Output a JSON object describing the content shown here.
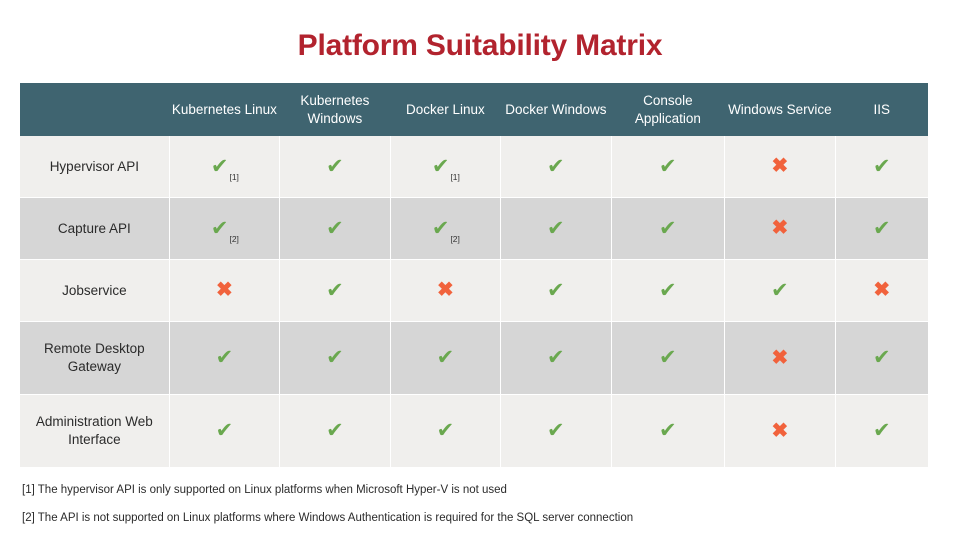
{
  "title": "Platform Suitability Matrix",
  "colors": {
    "title": "#b2232e",
    "header_bg": "#3f6470",
    "row_light": "#f0efed",
    "row_dark": "#d6d6d6",
    "check": "#6aa84f",
    "cross": "#f1623c"
  },
  "table": {
    "corner_header": "",
    "columns": [
      "Kubernetes Linux",
      "Kubernetes Windows",
      "Docker Linux",
      "Docker Windows",
      "Console Application",
      "Windows Service",
      "IIS"
    ],
    "rows": [
      {
        "label": "Hypervisor API",
        "cells": [
          {
            "mark": "check",
            "note": "[1]"
          },
          {
            "mark": "check",
            "note": ""
          },
          {
            "mark": "check",
            "note": "[1]"
          },
          {
            "mark": "check",
            "note": ""
          },
          {
            "mark": "check",
            "note": ""
          },
          {
            "mark": "cross",
            "note": ""
          },
          {
            "mark": "check",
            "note": ""
          }
        ]
      },
      {
        "label": "Capture API",
        "cells": [
          {
            "mark": "check",
            "note": "[2]"
          },
          {
            "mark": "check",
            "note": ""
          },
          {
            "mark": "check",
            "note": "[2]"
          },
          {
            "mark": "check",
            "note": ""
          },
          {
            "mark": "check",
            "note": ""
          },
          {
            "mark": "cross",
            "note": ""
          },
          {
            "mark": "check",
            "note": ""
          }
        ]
      },
      {
        "label": "Jobservice",
        "cells": [
          {
            "mark": "cross",
            "note": ""
          },
          {
            "mark": "check",
            "note": ""
          },
          {
            "mark": "cross",
            "note": ""
          },
          {
            "mark": "check",
            "note": ""
          },
          {
            "mark": "check",
            "note": ""
          },
          {
            "mark": "check",
            "note": ""
          },
          {
            "mark": "cross",
            "note": ""
          }
        ]
      },
      {
        "label": "Remote Desktop Gateway",
        "cells": [
          {
            "mark": "check",
            "note": ""
          },
          {
            "mark": "check",
            "note": ""
          },
          {
            "mark": "check",
            "note": ""
          },
          {
            "mark": "check",
            "note": ""
          },
          {
            "mark": "check",
            "note": ""
          },
          {
            "mark": "cross",
            "note": ""
          },
          {
            "mark": "check",
            "note": ""
          }
        ]
      },
      {
        "label": "Administration Web Interface",
        "cells": [
          {
            "mark": "check",
            "note": ""
          },
          {
            "mark": "check",
            "note": ""
          },
          {
            "mark": "check",
            "note": ""
          },
          {
            "mark": "check",
            "note": ""
          },
          {
            "mark": "check",
            "note": ""
          },
          {
            "mark": "cross",
            "note": ""
          },
          {
            "mark": "check",
            "note": ""
          }
        ]
      }
    ]
  },
  "footnotes": [
    "[1] The hypervisor API is only supported on Linux platforms when Microsoft Hyper-V is not used",
    "[2] The API is not supported on Linux platforms where Windows Authentication is required for the SQL server connection"
  ],
  "glyphs": {
    "check": "✔",
    "cross": "✖"
  }
}
